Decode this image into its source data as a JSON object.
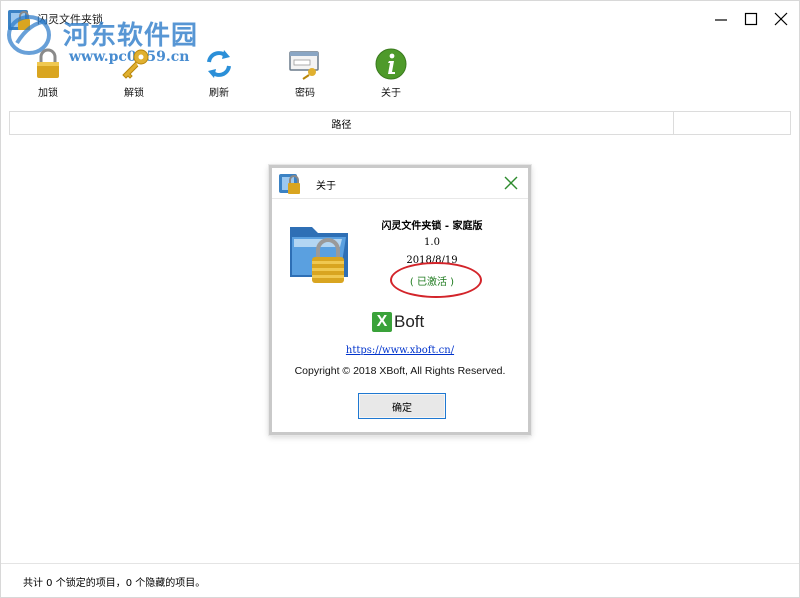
{
  "window": {
    "title": "闪灵文件夹锁",
    "icon": "folder-lock-icon"
  },
  "watermark": {
    "title": "河东软件园",
    "url": "www.pc0359.cn"
  },
  "toolbar": {
    "items": [
      {
        "label": "加锁",
        "icon": "lock-icon"
      },
      {
        "label": "解锁",
        "icon": "key-icon"
      },
      {
        "label": "刷新",
        "icon": "refresh-icon"
      },
      {
        "label": "密码",
        "icon": "password-icon"
      },
      {
        "label": "关于",
        "icon": "info-icon"
      }
    ]
  },
  "list": {
    "columns": [
      "路径"
    ]
  },
  "status": {
    "text": "共计 0 个锁定的项目，0 个隐藏的项目。"
  },
  "about_dialog": {
    "title": "关于",
    "product": "闪灵文件夹锁 - 家庭版",
    "version": "1.0",
    "date": "2018/8/19",
    "activation": "( 已激活 )",
    "brand": {
      "box": "X",
      "text": "Boft"
    },
    "link": "https://www.xboft.cn/",
    "copyright": "Copyright © 2018 XBoft, All Rights Reserved.",
    "ok_label": "确定"
  },
  "colors": {
    "activated": "#1d7a1d",
    "annotation": "#d3242a",
    "link": "#0033cc",
    "brand_green": "#3aa23a",
    "watermark": "#2878c8"
  }
}
